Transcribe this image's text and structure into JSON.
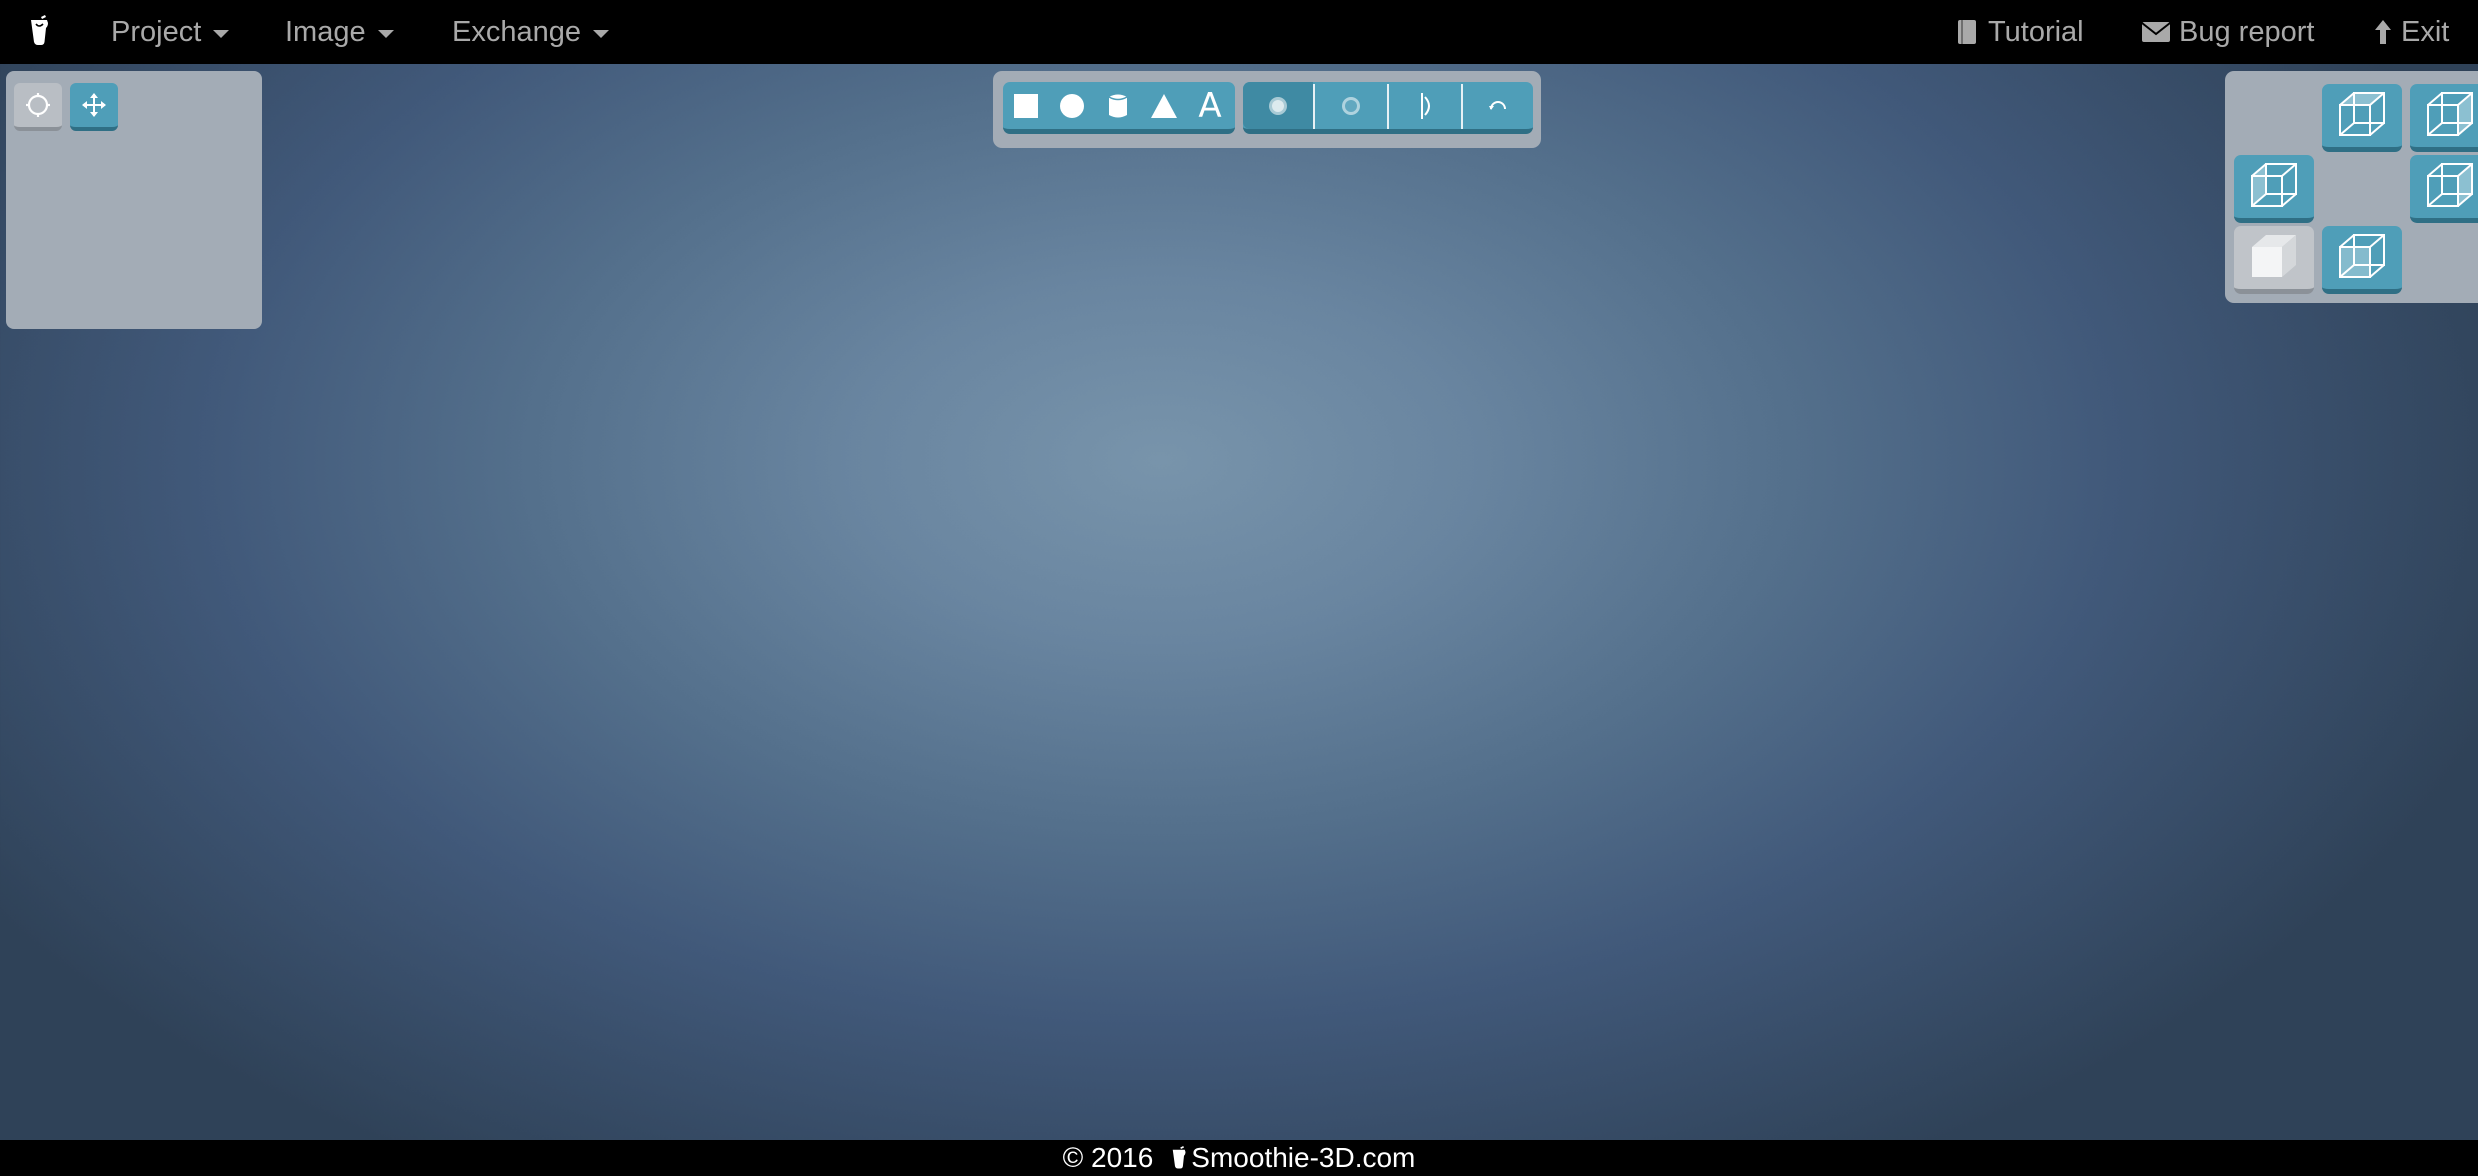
{
  "nav": {
    "project_label": "Project",
    "image_label": "Image",
    "exchange_label": "Exchange",
    "tutorial_label": "Tutorial",
    "bug_report_label": "Bug report",
    "exit_label": "Exit"
  },
  "left_panel": {
    "tools": [
      {
        "icon": "rotate-circle-icon",
        "active": true
      },
      {
        "icon": "move-arrows-icon",
        "active": false
      }
    ]
  },
  "toolbar": {
    "shapes": [
      "cube-icon",
      "sphere-icon",
      "cylinder-icon",
      "cone-icon",
      "text-icon"
    ],
    "text_glyph": "A",
    "operations": [
      "union-icon",
      "subtract-icon",
      "mirror-icon",
      "revolve-icon"
    ]
  },
  "views": [
    "view-top-front-icon",
    "view-top-right-icon",
    "view-left-icon",
    "view-right-icon",
    "view-front-solid-icon",
    "view-back-icon"
  ],
  "colors": {
    "teal": "#4f9eb8",
    "panel": "#a3acb6",
    "nav_text": "#a9a9a9"
  },
  "footer": {
    "copyright": "© 2016",
    "site": "Smoothie-3D.com"
  }
}
